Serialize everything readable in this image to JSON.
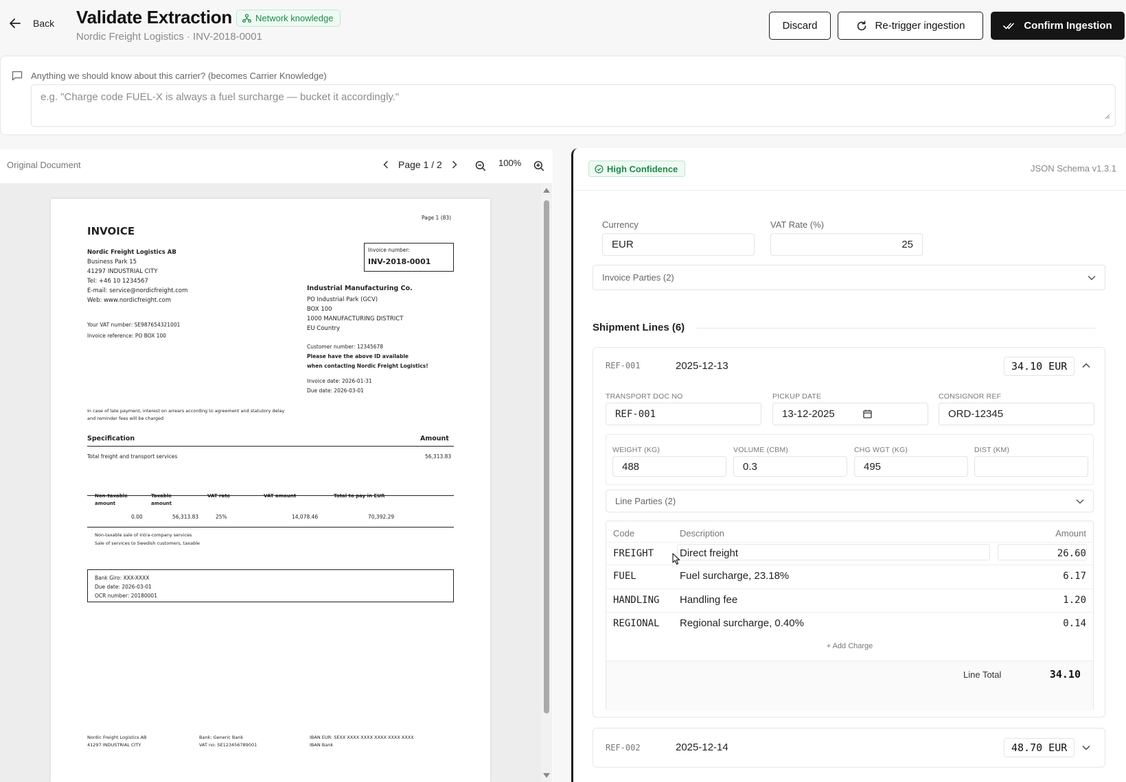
{
  "header": {
    "back_label": "Back",
    "title": "Validate Extraction",
    "badge": "Network knowledge",
    "subtitle": "Nordic Freight Logistics · INV-2018-0001",
    "discard_label": "Discard",
    "retrigger_label": "Re-trigger ingestion",
    "confirm_label": "Confirm Ingestion"
  },
  "knowledge": {
    "label": "Anything we should know about this carrier? (becomes Carrier Knowledge)",
    "placeholder": "e.g. \"Charge code FUEL-X is always a fuel surcharge — bucket it accordingly.\""
  },
  "document": {
    "label": "Original Document",
    "page_indicator": "Page 1 / 2",
    "zoom": "100%",
    "invoice": {
      "title": "INVOICE",
      "page_ref": "Page 1 (83)",
      "sender_name": "Nordic Freight Logistics AB",
      "sender_lines": [
        "Business Park 15",
        "41297 INDUSTRIAL CITY",
        "Tel: +46 10 1234567",
        "E-mail: service@nordicfreight.com",
        "Web: www.nordicfreight.com"
      ],
      "vat_line": "Your VAT number: SE987654321001",
      "ref_line": "Invoice reference: PO BOX 100",
      "inv_no_label": "Invoice number:",
      "inv_no": "INV-2018-0001",
      "recipient_name": "Industrial Manufacturing Co.",
      "recipient_lines": [
        "PO Industrial Park (GCV)",
        "BOX 100",
        "1000 MANUFACTURING DISTRICT",
        "EU Country"
      ],
      "customer_no": "Customer number: 12345678",
      "notice_1": "Please have the above ID available",
      "notice_2": "when contacting Nordic Freight Logistics!",
      "invoice_date": "Invoice date: 2026-01-31",
      "due_date": "Due date: 2026-03-01",
      "late_1": "In case of late payment, interest on arrears according to agreement and statutory delay",
      "late_2": "and reminder fees will be charged",
      "spec_label": "Specification",
      "amount_label": "Amount",
      "spec_item": "Total freight and transport services",
      "spec_amount": "56,313.83",
      "vat_headers": [
        "Non-taxable amount",
        "Taxable amount",
        "VAT rate",
        "VAT amount",
        "Total to pay in EUR"
      ],
      "vat_values": [
        "0.00",
        "56,313.83",
        "25%",
        "14,078.46",
        "70,392.29"
      ],
      "vat_note_1": "Non-taxable sale of intra-company services",
      "vat_note_2": "Sale of services to Swedish customers, taxable",
      "bank_giro": "Bank Giro: XXX-XXXX",
      "bank_due": "Due date: 2026-03-01",
      "bank_ocr": "OCR number: 20180001",
      "footer_1": "Nordic Freight Logistics AB",
      "footer_2": "41297 INDUSTRIAL CITY",
      "footer_3": "Bank: Generic Bank",
      "footer_4": "VAT no: SE123456789001",
      "footer_5": "IBAN EUR: SEXX XXXX XXXX XXXX XXXX XXXX",
      "footer_6": "IBAN Bank"
    }
  },
  "extraction": {
    "confidence": "High Confidence",
    "schema": "JSON Schema v1.3.1",
    "currency_label": "Currency",
    "currency": "EUR",
    "vat_label": "VAT Rate (%)",
    "vat": "25",
    "invoice_parties": "Invoice Parties (2)",
    "shipment_title": "Shipment Lines (6)",
    "lines": [
      {
        "ref": "REF-001",
        "date": "2025-12-13",
        "amount": "34.10 EUR",
        "transport_doc_label": "TRANSPORT DOC NO",
        "transport_doc": "REF-001",
        "pickup_label": "PICKUP DATE",
        "pickup": "13-12-2025",
        "consignor_label": "CONSIGNOR REF",
        "consignor": "ORD-12345",
        "weight_label": "WEIGHT (KG)",
        "weight": "488",
        "volume_label": "VOLUME (CBM)",
        "volume": "0.3",
        "chg_label": "CHG WGT (KG)",
        "chg": "495",
        "dist_label": "DIST (KM)",
        "dist": "",
        "line_parties": "Line Parties (2)",
        "charges_headers": {
          "code": "Code",
          "description": "Description",
          "amount": "Amount"
        },
        "charges": [
          {
            "code": "FREIGHT",
            "description": "Direct freight",
            "amount": "26.60"
          },
          {
            "code": "FUEL",
            "description": "Fuel surcharge, 23.18%",
            "amount": "6.17"
          },
          {
            "code": "HANDLING",
            "description": "Handling fee",
            "amount": "1.20"
          },
          {
            "code": "REGIONAL",
            "description": "Regional surcharge, 0.40%",
            "amount": "0.14"
          }
        ],
        "add_charge": "+ Add Charge",
        "line_total_label": "Line Total",
        "line_total": "34.10"
      },
      {
        "ref": "REF-002",
        "date": "2025-12-14",
        "amount": "48.70 EUR"
      }
    ]
  }
}
